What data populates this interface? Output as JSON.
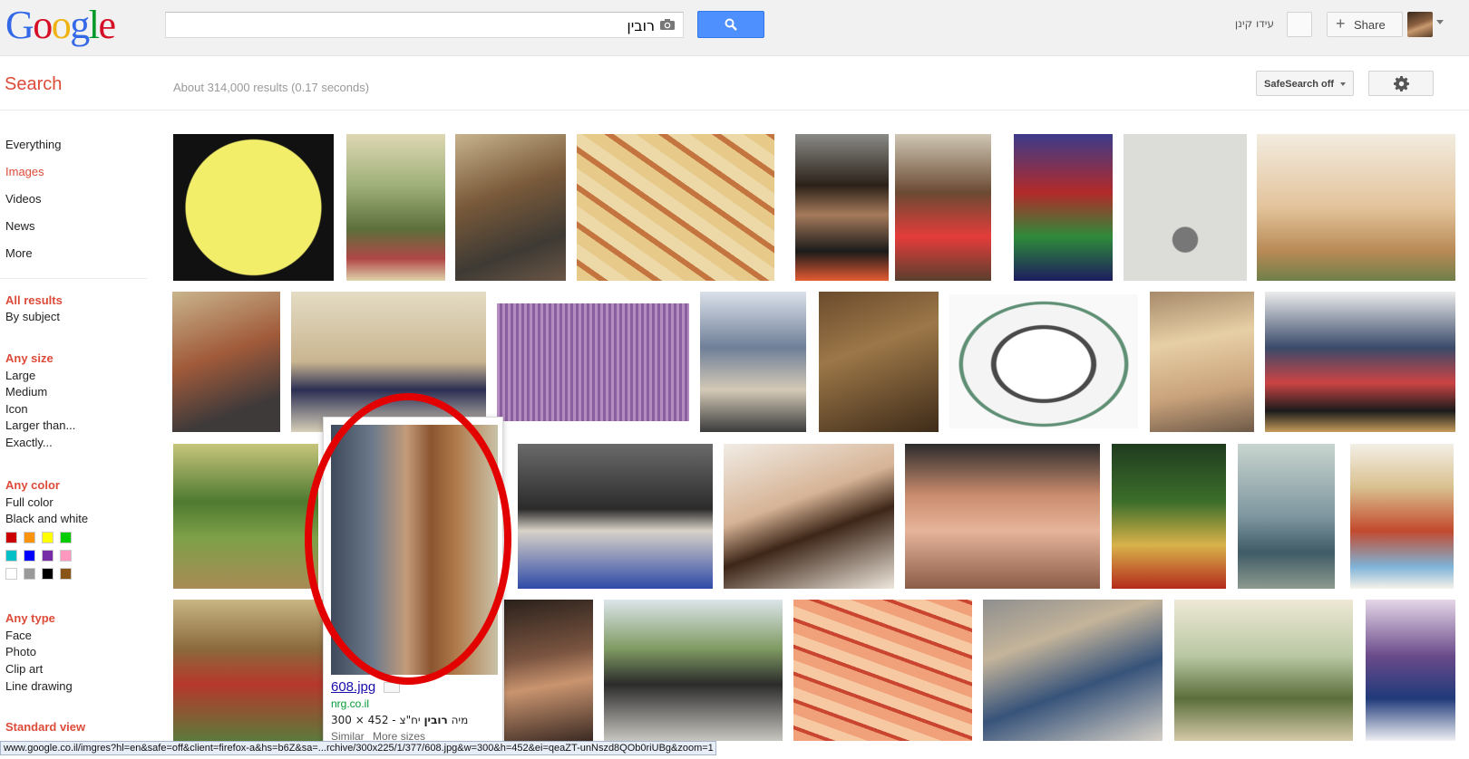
{
  "logo": {
    "letters": [
      {
        "ch": "G",
        "color": "#3369e8"
      },
      {
        "ch": "o",
        "color": "#d50f25"
      },
      {
        "ch": "o",
        "color": "#eeb211"
      },
      {
        "ch": "g",
        "color": "#3369e8"
      },
      {
        "ch": "l",
        "color": "#009925"
      },
      {
        "ch": "e",
        "color": "#d50f25"
      }
    ]
  },
  "search": {
    "query": "רובין",
    "button_icon": "magnifier-icon",
    "camera_icon": "camera-icon"
  },
  "header": {
    "username": "עידו קינן",
    "share_label": "Share"
  },
  "subheader": {
    "title": "Search",
    "stats": "About 314,000 results (0.17 seconds)",
    "safesearch_label": "SafeSearch off",
    "settings_icon": "gear-icon"
  },
  "sidebar": {
    "nav": [
      "Everything",
      "Images",
      "Videos",
      "News",
      "More"
    ],
    "active": "Images",
    "all_results": "All results",
    "by_subject": "By subject",
    "size_head": "Any size",
    "sizes": [
      "Large",
      "Medium",
      "Icon",
      "Larger than...",
      "Exactly..."
    ],
    "color_head": "Any color",
    "colors_text": [
      "Full color",
      "Black and white"
    ],
    "swatches": [
      "#cc0000",
      "#fb940b",
      "#ffff00",
      "#00cc00",
      "#03c0c6",
      "#0000ff",
      "#762ca7",
      "#ff98bf",
      "#ffffff",
      "#999999",
      "#000000",
      "#885418"
    ],
    "type_head": "Any type",
    "types": [
      "Face",
      "Photo",
      "Clip art",
      "Line drawing"
    ],
    "view_head": "Standard view"
  },
  "hover_card": {
    "filename": "608.jpg",
    "domain": "nrg.co.il",
    "desc_prefix": "300 × 452 - ",
    "desc_text": "מיה ",
    "desc_bold": "רובין",
    "desc_suffix": " יח\"צ",
    "links": [
      "Similar",
      "More sizes"
    ]
  },
  "status_bar": "www.google.co.il/imgres?hl=en&safe=off&client=firefox-a&hs=b6Z&sa=...rchive/300x225/1/377/608.jpg&w=300&h=452&ei=qeaZT-unNszd8QOb0riUBg&zoom=1"
}
